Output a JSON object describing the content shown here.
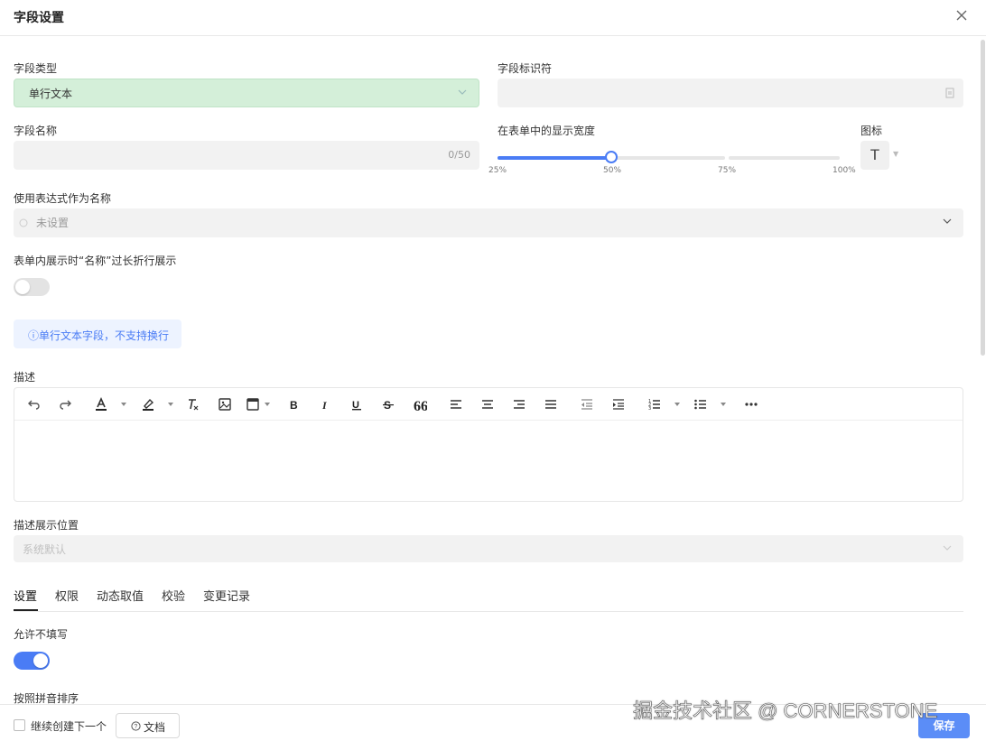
{
  "dialog": {
    "title": "字段设置",
    "close_icon": "close-icon"
  },
  "fields": {
    "type": {
      "label": "字段类型",
      "value": "单行文本"
    },
    "identifier": {
      "label": "字段标识符",
      "value": ""
    },
    "name": {
      "label": "字段名称",
      "value": "",
      "counter": "0/50"
    },
    "width": {
      "label": "在表单中的显示宽度",
      "value_percent": 50,
      "ticks": [
        "25%",
        "50%",
        "75%",
        "100%"
      ]
    },
    "icon": {
      "label": "图标",
      "value": "T"
    },
    "expression": {
      "label": "使用表达式作为名称",
      "placeholder": "未设置"
    },
    "wrap": {
      "label": "表单内展示时“名称”过长折行展示",
      "enabled": false
    },
    "tip": "单行文本字段，不支持换行",
    "description": {
      "label": "描述",
      "toolbar": [
        "undo-icon",
        "redo-icon",
        "font-color-icon",
        "highlight-icon",
        "clear-format-icon",
        "image-icon",
        "embed-icon",
        "bold-icon",
        "italic-icon",
        "underline-icon",
        "strikethrough-icon",
        "quote-icon",
        "align-left-icon",
        "align-center-icon",
        "align-right-icon",
        "align-justify-icon",
        "outdent-icon",
        "indent-icon",
        "ordered-list-icon",
        "bullet-list-icon",
        "more-icon"
      ]
    },
    "desc_position": {
      "label": "描述展示位置",
      "placeholder": "系统默认"
    }
  },
  "tabs": [
    {
      "label": "设置",
      "active": true
    },
    {
      "label": "权限"
    },
    {
      "label": "动态取值"
    },
    {
      "label": "校验"
    },
    {
      "label": "变更记录"
    }
  ],
  "settings": {
    "allow_empty": {
      "label": "允许不填写",
      "enabled": true
    },
    "pinyin_sort": {
      "label": "按照拼音排序"
    }
  },
  "footer": {
    "continue_label": "继续创建下一个",
    "doc_label": "文档",
    "save_label": "保存"
  },
  "watermark": "掘金技术社区 @ CORNERSTONE",
  "colors": {
    "accent": "#4a7cf5",
    "green_field": "#d4efd9",
    "tip_bg": "#edf3ff"
  }
}
